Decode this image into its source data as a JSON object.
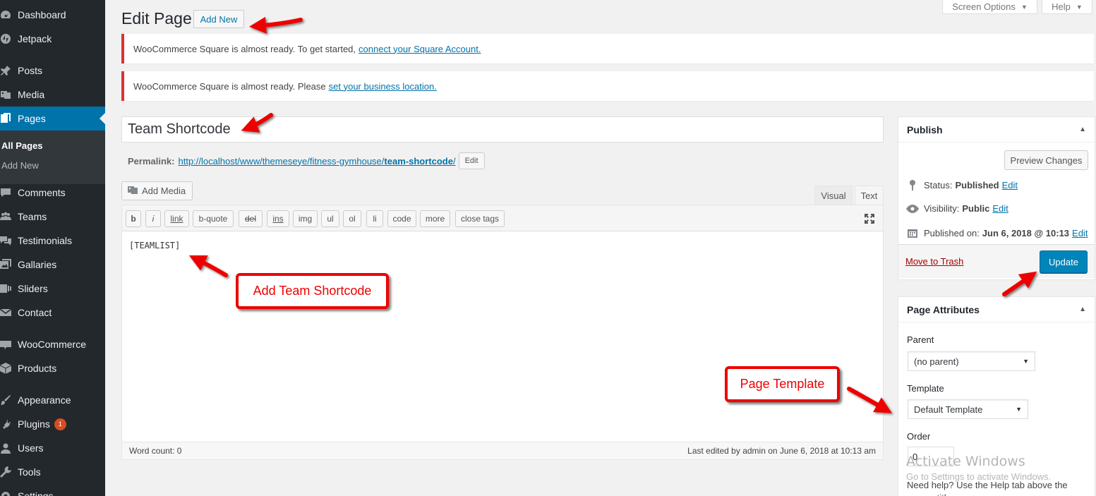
{
  "sidebar": {
    "items": [
      {
        "label": "Dashboard",
        "icon": "dashboard-icon"
      },
      {
        "label": "Jetpack",
        "icon": "jetpack-icon"
      },
      {
        "label": "Posts",
        "icon": "pin-icon"
      },
      {
        "label": "Media",
        "icon": "media-icon"
      },
      {
        "label": "Pages",
        "icon": "pages-icon"
      },
      {
        "label": "Comments",
        "icon": "comments-icon"
      },
      {
        "label": "Teams",
        "icon": "teams-icon"
      },
      {
        "label": "Testimonials",
        "icon": "testimonials-icon"
      },
      {
        "label": "Gallaries",
        "icon": "gallery-icon"
      },
      {
        "label": "Sliders",
        "icon": "sliders-icon"
      },
      {
        "label": "Contact",
        "icon": "mail-icon"
      },
      {
        "label": "WooCommerce",
        "icon": "woocommerce-icon"
      },
      {
        "label": "Products",
        "icon": "products-icon"
      },
      {
        "label": "Appearance",
        "icon": "appearance-icon"
      },
      {
        "label": "Plugins",
        "icon": "plugins-icon",
        "badge": "1"
      },
      {
        "label": "Users",
        "icon": "users-icon"
      },
      {
        "label": "Tools",
        "icon": "tools-icon"
      },
      {
        "label": "Settings",
        "icon": "settings-icon"
      }
    ],
    "submenu": {
      "all_pages": "All Pages",
      "add_new": "Add New"
    }
  },
  "screen_meta": {
    "screen_options": "Screen Options",
    "help": "Help"
  },
  "header": {
    "title": "Edit Page",
    "add_new": "Add New"
  },
  "notices": [
    {
      "text": "WooCommerce Square is almost ready. To get started,",
      "link": "connect your Square Account."
    },
    {
      "text": "WooCommerce Square is almost ready. Please",
      "link": "set your business location."
    }
  ],
  "post": {
    "title": "Team Shortcode",
    "permalink_label": "Permalink:",
    "permalink_base": "http://localhost/www/themeseye/fitness-gymhouse/",
    "permalink_slug": "team-shortcode",
    "permalink_end": "/",
    "permalink_edit": "Edit"
  },
  "editor": {
    "add_media": "Add Media",
    "tabs": {
      "visual": "Visual",
      "text": "Text"
    },
    "quicktags": [
      "b",
      "i",
      "link",
      "b-quote",
      "del",
      "ins",
      "img",
      "ul",
      "ol",
      "li",
      "code",
      "more",
      "close tags"
    ],
    "content": "[TEAMLIST]",
    "word_count": "Word count: 0",
    "last_edited": "Last edited by admin on June 6, 2018 at 10:13 am"
  },
  "publish": {
    "title": "Publish",
    "preview": "Preview Changes",
    "status_label": "Status:",
    "status_value": "Published",
    "visibility_label": "Visibility:",
    "visibility_value": "Public",
    "published_label": "Published on:",
    "published_value": "Jun 6, 2018 @ 10:13",
    "edit": "Edit",
    "trash": "Move to Trash",
    "update": "Update"
  },
  "page_attributes": {
    "title": "Page Attributes",
    "parent_label": "Parent",
    "parent_value": "(no parent)",
    "template_label": "Template",
    "template_value": "Default Template",
    "order_label": "Order",
    "order_value": "0",
    "help": "Need help? Use the Help tab above the screen title."
  },
  "watermark": {
    "title": "Activate Windows",
    "sub": "Go to Settings to activate Windows."
  },
  "annotations": {
    "shortcode": "Add Team Shortcode",
    "template": "Page Template"
  },
  "colors": {
    "sidebar_bg": "#23282d",
    "accent": "#0073aa",
    "annotation_red": "#e00000",
    "notice_red": "#dc3232"
  }
}
